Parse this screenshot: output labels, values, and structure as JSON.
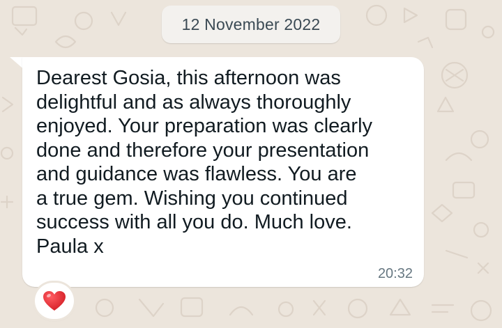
{
  "chat": {
    "date_separator": "12 November 2022",
    "message": {
      "text": "Dearest Gosia, this afternoon was\ndelightful and as always thoroughly\nenjoyed.  Your preparation was clearly\ndone and therefore your presentation\nand guidance was flawless. You are\na true gem. Wishing you continued\nsuccess with all you do. Much love.\nPaula x",
      "time": "20:32",
      "reaction": {
        "icon": "red-heart-icon",
        "color": "#e0242c"
      }
    }
  },
  "colors": {
    "wallpaper": "#ece5dc",
    "bubble": "#ffffff",
    "text": "#111b21",
    "meta_text": "#667781"
  }
}
